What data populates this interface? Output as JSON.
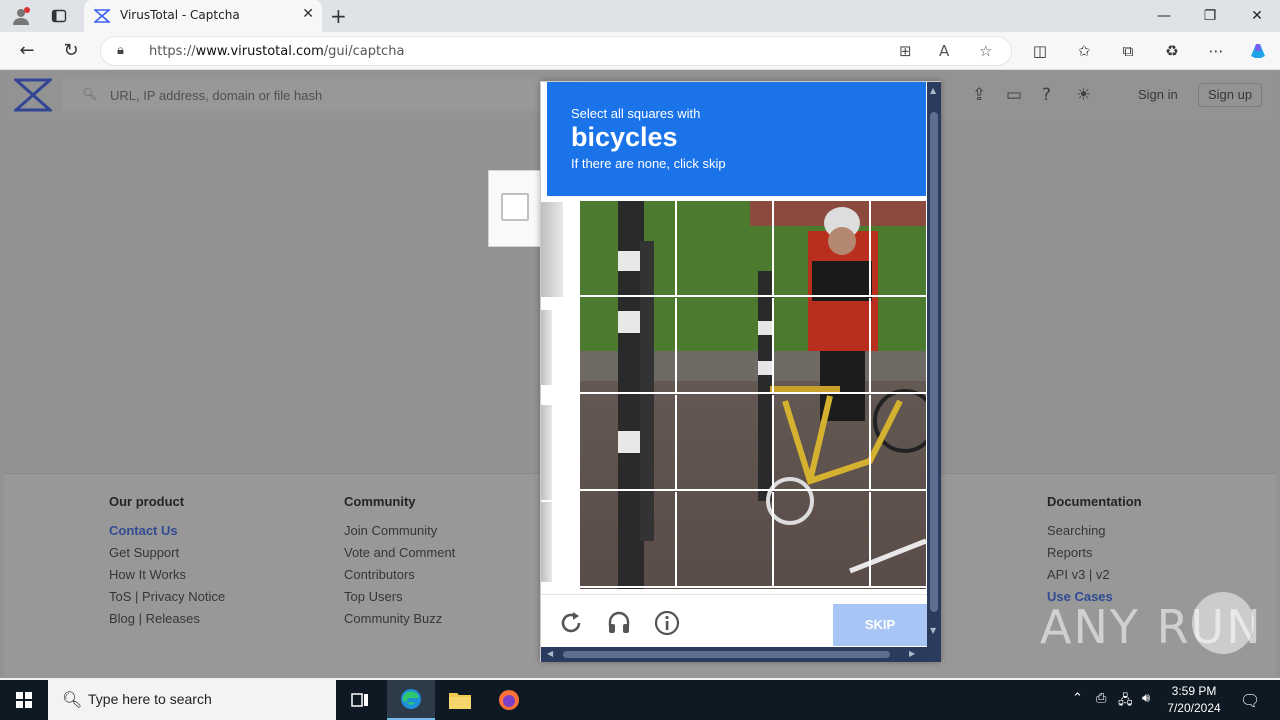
{
  "browser": {
    "tab_title": "VirusTotal - Captcha",
    "url_prefix": "https://",
    "url_host": "www.virustotal.com",
    "url_path": "/gui/captcha",
    "accent": "#1a73e8"
  },
  "vt": {
    "search_placeholder": "URL, IP address, domain or file hash",
    "sign_in": "Sign in",
    "sign_up": "Sign up"
  },
  "footer": {
    "col1": {
      "title": "Our product",
      "links": [
        "Contact Us",
        "Get Support",
        "How It Works",
        "ToS | Privacy Notice",
        "Blog | Releases"
      ]
    },
    "col2": {
      "title": "Community",
      "links": [
        "Join Community",
        "Vote and Comment",
        "Contributors",
        "Top Users",
        "Community Buzz"
      ]
    },
    "col3": {
      "title": "Documentation",
      "links": [
        "Searching",
        "Reports",
        "API v3 | v2",
        "Use Cases"
      ]
    }
  },
  "captcha": {
    "line1": "Select all squares with",
    "object": "bicycles",
    "line3": "If there are none, click skip",
    "skip_label": "SKIP",
    "header_color": "#1a73e8",
    "skip_color": "#a7c5f5"
  },
  "watermark": "ANY RUN",
  "taskbar": {
    "search_placeholder": "Type here to search",
    "time": "3:59 PM",
    "date": "7/20/2024"
  }
}
